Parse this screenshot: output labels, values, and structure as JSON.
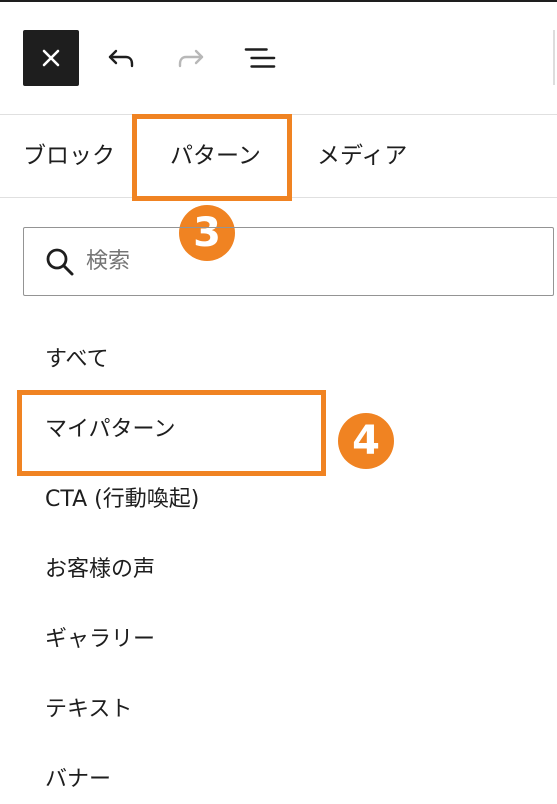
{
  "toolbar": {
    "close_icon": "close-icon",
    "undo_icon": "undo-icon",
    "redo_icon": "redo-icon",
    "list_view_icon": "list-view-icon"
  },
  "tabs": [
    {
      "label": "ブロック"
    },
    {
      "label": "パターン"
    },
    {
      "label": "メディア"
    }
  ],
  "search": {
    "placeholder": "検索",
    "value": ""
  },
  "categories": [
    {
      "label": "すべて"
    },
    {
      "label": "マイパターン"
    },
    {
      "label": "CTA (行動喚起)"
    },
    {
      "label": "お客様の声"
    },
    {
      "label": "ギャラリー"
    },
    {
      "label": "テキスト"
    },
    {
      "label": "バナー"
    }
  ],
  "annotations": {
    "step_tab": "3",
    "step_item": "4",
    "highlight_color": "#f08322"
  },
  "colors": {
    "dark": "#1e1e1e",
    "border": "#949494",
    "accent": "#f08322"
  }
}
